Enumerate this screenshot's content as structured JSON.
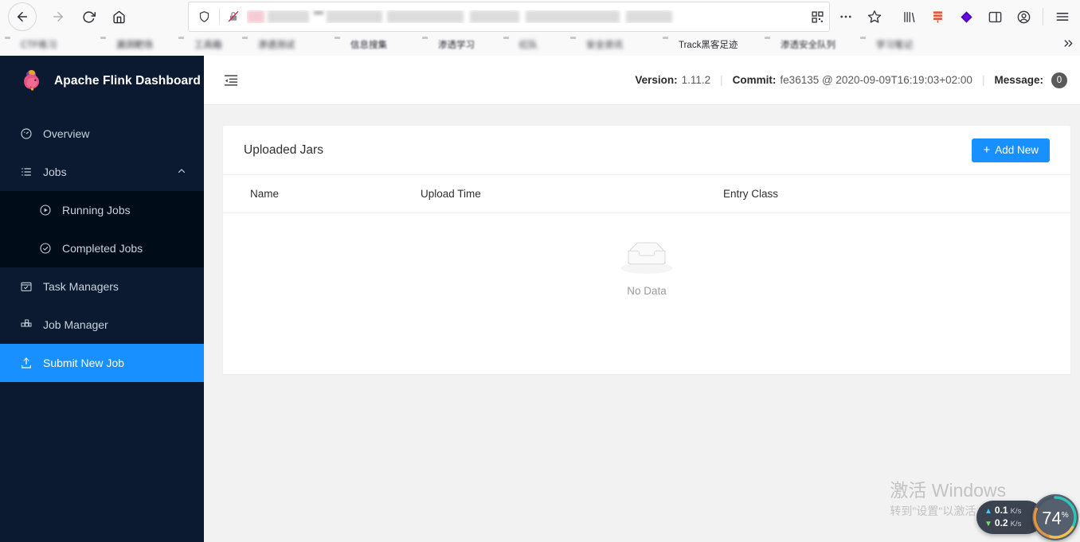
{
  "browser": {
    "nav": {
      "back": "back-arrow",
      "forward": "forward-arrow",
      "reload": "reload",
      "home": "home"
    },
    "urlbar": {
      "shield_icon": "shield-icon",
      "permission_icon": "lock-slash-icon",
      "url_text": ""
    },
    "toolbar_icons": [
      "qr-code-icon",
      "ellipsis-icon",
      "star-icon",
      "library-icon",
      "extension-icon",
      "diamond-icon",
      "sidebar-icon",
      "account-icon",
      "hamburger-menu-icon"
    ],
    "bookmarks": [
      {
        "label": "CTF练习",
        "blur": "full"
      },
      {
        "label": "漏洞靶场",
        "blur": "full"
      },
      {
        "label": "工具箱",
        "blur": "full"
      },
      {
        "label": "渗透测试",
        "blur": "full"
      },
      {
        "label": "信息搜集",
        "blur": "semi"
      },
      {
        "label": "渗透学习",
        "blur": "semi"
      },
      {
        "label": "红队",
        "blur": "full"
      },
      {
        "label": "安全资讯",
        "blur": "full"
      },
      {
        "label": "Track黑客足迹",
        "blur": "clear"
      },
      {
        "label": "渗透安全队列",
        "blur": "semi"
      },
      {
        "label": "学习笔记",
        "blur": "full"
      }
    ],
    "overflow": "chevron-double-right"
  },
  "sidebar": {
    "brand": {
      "title": "Apache Flink Dashboard",
      "logo": "flink-squirrel-logo"
    },
    "items": [
      {
        "label": "Overview",
        "icon": "dashboard-icon",
        "selected": false
      },
      {
        "label": "Jobs",
        "icon": "list-icon",
        "selected": false,
        "expanded": true
      },
      {
        "label": "Running Jobs",
        "icon": "play-circle-icon",
        "selected": false,
        "sub": true
      },
      {
        "label": "Completed Jobs",
        "icon": "check-circle-icon",
        "selected": false,
        "sub": true
      },
      {
        "label": "Task Managers",
        "icon": "task-icon",
        "selected": false
      },
      {
        "label": "Job Manager",
        "icon": "blocks-icon",
        "selected": false
      },
      {
        "label": "Submit New Job",
        "icon": "upload-icon",
        "selected": true
      }
    ]
  },
  "topbar": {
    "fold_icon": "menu-fold-icon",
    "version_label": "Version:",
    "version_value": "1.11.2",
    "commit_label": "Commit:",
    "commit_value": "fe36135 @ 2020-09-09T16:19:03+02:00",
    "message_label": "Message:",
    "message_count": "0",
    "separator": "|"
  },
  "card": {
    "title": "Uploaded Jars",
    "add_button": "Add New",
    "add_icon": "plus-icon",
    "columns": [
      "Name",
      "Upload Time",
      "Entry Class"
    ],
    "rows": [],
    "empty_text": "No Data",
    "empty_icon": "empty-box-icon"
  },
  "watermark": {
    "line1": "激活 Windows",
    "line2": "转到\"设置\"以激活 Windows。"
  },
  "netspeed": {
    "upload": "0.1",
    "upload_unit": "K/s",
    "download": "0.2",
    "download_unit": "K/s",
    "gauge_value": "74",
    "gauge_unit": "%"
  },
  "colors": {
    "accent": "#1890ff",
    "sidebar_bg": "#0b1a30",
    "submenu_bg": "#000c17",
    "page_bg": "#f2f2f2",
    "badge_bg": "#595959"
  }
}
